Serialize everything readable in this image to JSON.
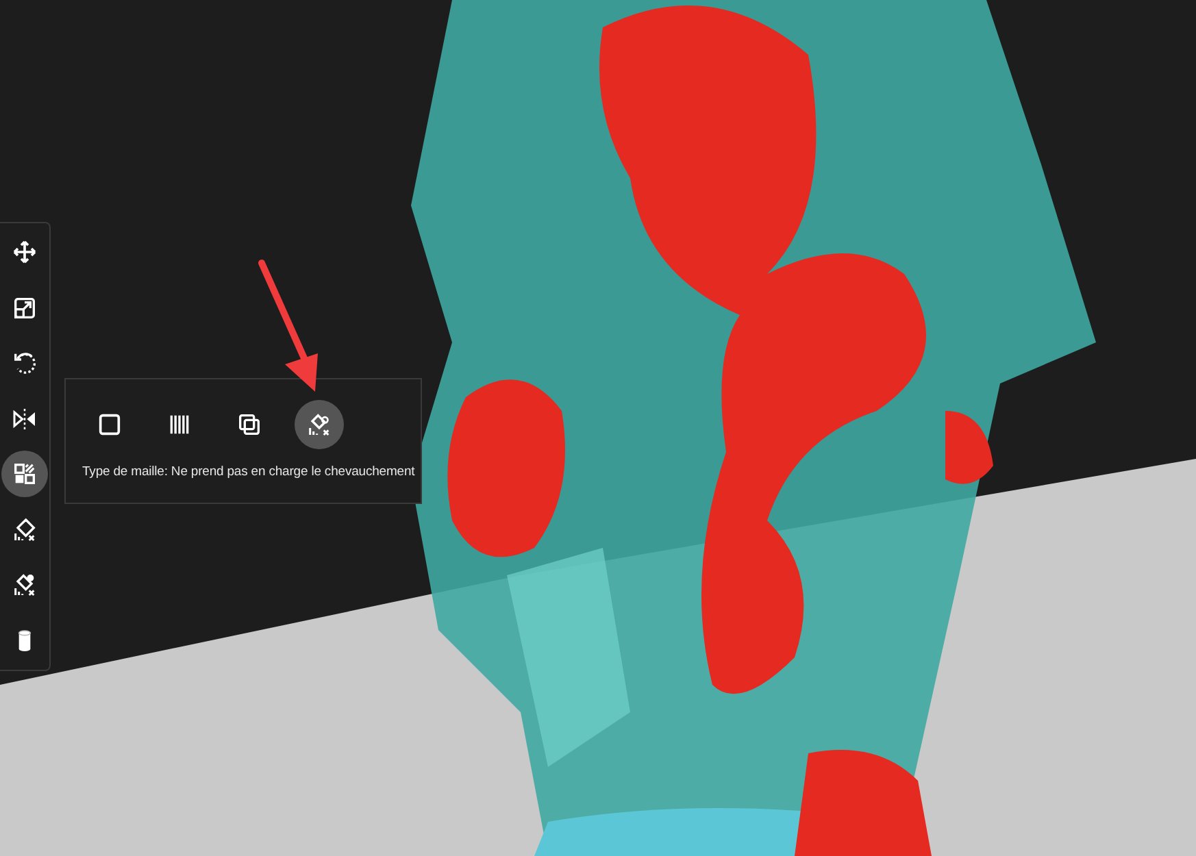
{
  "toolbar": {
    "tools": [
      {
        "kind": "move",
        "selected": false
      },
      {
        "kind": "scale",
        "selected": false
      },
      {
        "kind": "rotate",
        "selected": false
      },
      {
        "kind": "mirror",
        "selected": false
      },
      {
        "kind": "per-model",
        "selected": true
      },
      {
        "kind": "support-blocker",
        "selected": false
      },
      {
        "kind": "custom-support",
        "selected": false
      },
      {
        "kind": "cylinder",
        "selected": false
      }
    ]
  },
  "mesh_popup": {
    "options": [
      {
        "kind": "normal",
        "selected": false
      },
      {
        "kind": "infill",
        "selected": false
      },
      {
        "kind": "overlap",
        "selected": false
      },
      {
        "kind": "no-support-overlap",
        "selected": true
      }
    ],
    "caption": "Type de maille: Ne prend pas en charge le chevauchement"
  }
}
